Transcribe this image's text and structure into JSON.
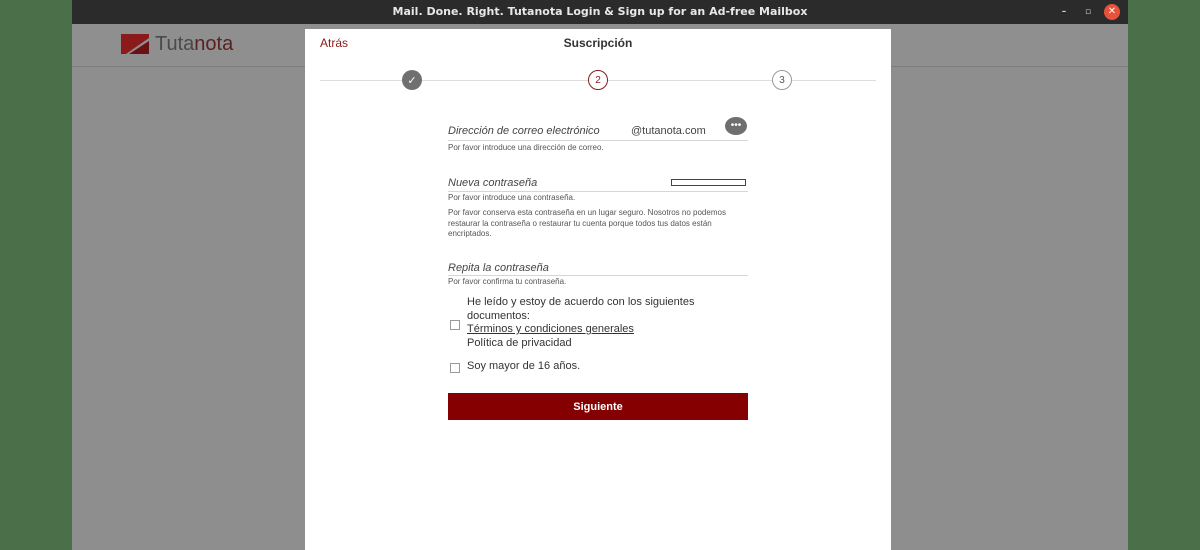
{
  "window": {
    "title": "Mail. Done. Right. Tutanota Login & Sign up for an Ad-free Mailbox",
    "controls": {
      "minimize": "–",
      "restore": "▫",
      "close": "✕"
    }
  },
  "app": {
    "logo_prefix": "Tuta",
    "logo_suffix": "nota"
  },
  "dialog": {
    "back_label": "Atrás",
    "title": "Suscripción",
    "steps": [
      {
        "label": "✓",
        "state": "done"
      },
      {
        "label": "2",
        "state": "active"
      },
      {
        "label": "3",
        "state": "todo"
      }
    ]
  },
  "form": {
    "email": {
      "label": "Dirección de correo electrónico",
      "domain": "@tutanota.com",
      "more_icon": "more-horizontal-icon",
      "help": "Por favor introduce una dirección de correo."
    },
    "password": {
      "label": "Nueva contraseña",
      "help": "Por favor introduce una contraseña.",
      "notice": "Por favor conserva esta contraseña en un lugar seguro. Nosotros no podemos restaurar la contraseña o restaurar tu cuenta porque todos tus datos están encriptados."
    },
    "repeat_password": {
      "label": "Repita la contraseña",
      "help": "Por favor confirma tu contraseña."
    },
    "terms": {
      "text": "He leído y estoy de acuerdo con los siguientes documentos:",
      "terms_link": "Términos y condiciones generales",
      "privacy_link": "Política de privacidad"
    },
    "age": {
      "text": "Soy mayor de 16 años."
    },
    "next_button": "Siguiente"
  },
  "colors": {
    "accent": "#850000",
    "link": "#8b1a1a",
    "overlay": "#8e8e8e",
    "titlebar": "#2b2b2b"
  }
}
